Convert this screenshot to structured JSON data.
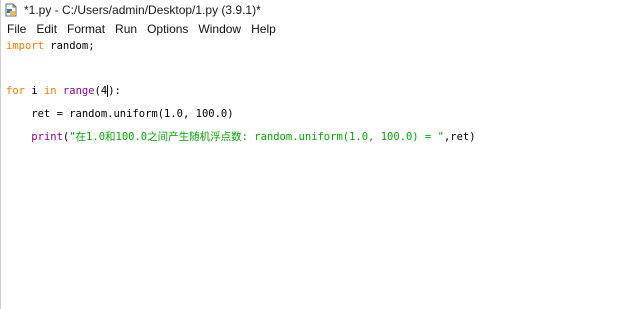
{
  "window": {
    "title": "*1.py - C:/Users/admin/Desktop/1.py (3.9.1)*"
  },
  "menu": {
    "items": [
      "File",
      "Edit",
      "Format",
      "Run",
      "Options",
      "Window",
      "Help"
    ]
  },
  "code": {
    "line1": {
      "kw": "import",
      "rest": " random;"
    },
    "line2": {
      "kw_for": "for",
      "mid": " i ",
      "kw_in": "in",
      "sp": " ",
      "builtin": "range",
      "open": "(",
      "num": "4",
      "close": "):"
    },
    "line3": {
      "text": "    ret = random.uniform(1.0, 100.0)"
    },
    "line4": {
      "indent": "    ",
      "builtin": "print",
      "open": "(",
      "string": "\"在1.0和100.0之间产生随机浮点数: random.uniform(1.0, 100.0) = \"",
      "rest": ",ret)"
    }
  },
  "icons": {
    "app": "idle-file-icon"
  },
  "colors": {
    "keyword": "#ff7700",
    "builtin": "#900090",
    "string": "#00aa00"
  }
}
